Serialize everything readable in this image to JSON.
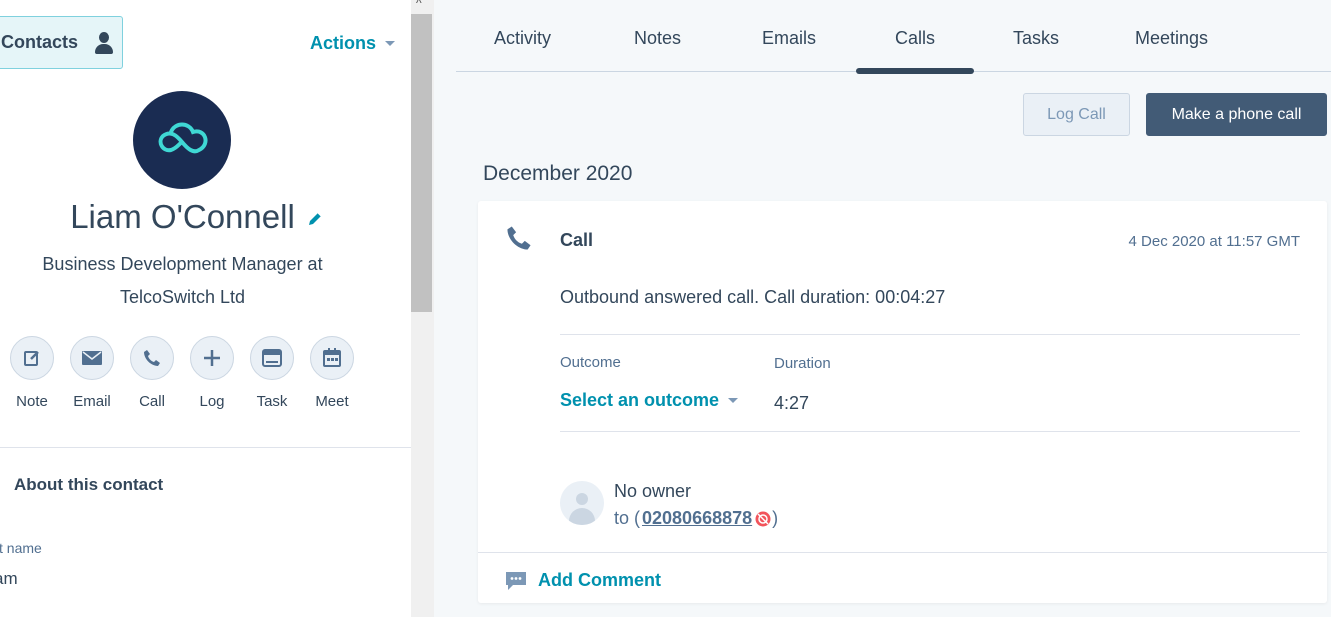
{
  "left": {
    "contacts_label": "Contacts",
    "actions_label": "Actions",
    "contact_name": "Liam O'Connell",
    "job_line1": "Business Development Manager at",
    "job_line2": "TelcoSwitch Ltd",
    "quick_actions": [
      {
        "label": "Note",
        "icon": "note-icon"
      },
      {
        "label": "Email",
        "icon": "email-icon"
      },
      {
        "label": "Call",
        "icon": "call-icon"
      },
      {
        "label": "Log",
        "icon": "plus-icon"
      },
      {
        "label": "Task",
        "icon": "task-icon"
      },
      {
        "label": "Meet",
        "icon": "calendar-icon"
      }
    ],
    "about_title": "About this contact",
    "first_name_label": "st name",
    "first_name_value": "am"
  },
  "tabs": [
    "Activity",
    "Notes",
    "Emails",
    "Calls",
    "Tasks",
    "Meetings"
  ],
  "active_tab": "Calls",
  "buttons": {
    "log_call": "Log Call",
    "make_call": "Make a phone call"
  },
  "month_heading": "December 2020",
  "call": {
    "title": "Call",
    "timestamp": "4 Dec 2020 at 11:57 GMT",
    "description": "Outbound answered call. Call duration: 00:04:27",
    "outcome_label": "Outcome",
    "outcome_value": "Select an outcome",
    "duration_label": "Duration",
    "duration_value": "4:27",
    "owner": "No owner",
    "to_prefix": "to (",
    "to_number": "02080668878",
    "to_suffix": ")",
    "add_comment": "Add Comment"
  },
  "colors": {
    "accent": "#0091ae",
    "dark_button": "#425b76",
    "avatar_bg": "#1a2c52",
    "logo_teal": "#3fd8d4"
  }
}
